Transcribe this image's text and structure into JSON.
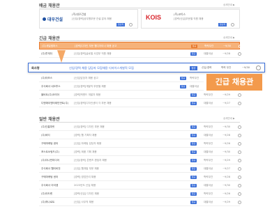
{
  "sections": {
    "premium_title": "배금 채용관",
    "premium_more": "상세안내 ▶",
    "urgent_title": "긴급 채용관",
    "urgent_more": "상세안내 ▶",
    "general_title": "일반 채용관",
    "general_more": "상세안내 ▶"
  },
  "premium_cards": [
    {
      "company": "(주)대우건설",
      "logo": "대우건설",
      "desc": "[신입/경력]공무원부문 건설 분야 채용",
      "tag": "정규직"
    },
    {
      "company": "(주)코이스",
      "logo": "KOIS",
      "desc": "[경력/신입]부문별 직원 채용",
      "tag": "정규직"
    }
  ],
  "urgent_rows": [
    {
      "company": "(주)세일캠퍼스",
      "title": "[경력]디자인 부문 웹디자이너 채용 공고",
      "badge": "정규",
      "edu": "학력무관",
      "date": "~9/30"
    },
    {
      "company": "(주)투게더",
      "title": "[신입/경력]글로벌 사업부 직원 채용",
      "badge": "정규",
      "edu": "대졸이상",
      "date": "~9/28"
    },
    {
      "company": "(주)타모스",
      "title": "[신입]담당자 채용 공고",
      "badge": "정규",
      "edu": "학력무관",
      "date": "~9/26"
    },
    {
      "company": "주식회사 네오투스",
      "title": "[신입/경력]개발직 부문별 채용",
      "badge": "정규",
      "edu": "대졸이상",
      "date": "~9/30"
    },
    {
      "company": "올비트(주)코리아",
      "title": "[경력]백엔드 개발자 채용",
      "badge": "정규",
      "edu": "학력무관",
      "date": "~9/29"
    },
    {
      "company": "디엔에이엔터테인먼트(주)",
      "title": "[신입/경력]디자인센터 각 부문 채용",
      "badge": "정규",
      "edu": "대졸이상",
      "date": "~9/27"
    }
  ],
  "highlight": {
    "company": "회사명",
    "title": "신입/경력 채용 담당자 모집채용 디자이스개발직 모집",
    "badge": "정규",
    "career": "신입/경력",
    "edu": "학력 무관",
    "date": "~9/30",
    "callout": "긴급 채용관"
  },
  "general_rows": [
    {
      "company": "(주)단홈피릿",
      "title": "[신입/경력] 디자인 부문 채용",
      "badge": "정규",
      "edu": "학력무관",
      "date": "~9/30"
    },
    {
      "company": "(주)비티",
      "title": "[경력] 웹 기획자 채용",
      "badge": "정규",
      "edu": "대졸이상",
      "date": "~9/28"
    },
    {
      "company": "구매마케팅 센터",
      "title": "[신입] 마케팅 담당자 채용",
      "badge": "정규",
      "edu": "학력무관",
      "date": "~9/26"
    },
    {
      "company": "포스트쏘링드(주)",
      "title": "[경력] 제품 기획 채용",
      "badge": "정규",
      "edu": "대졸이상",
      "date": "~9/30"
    },
    {
      "company": "(주)더나빈미디어",
      "title": "[신입/경력] 콘텐츠 편집자 채용",
      "badge": "정규",
      "edu": "학력무관",
      "date": "~9/29"
    },
    {
      "company": "주식회사 웹티비전",
      "title": "[신입] 웹개발 부문 채용",
      "badge": "정규",
      "edu": "대졸이상",
      "date": "~9/27"
    },
    {
      "company": "구매마케팅 센터",
      "title": "[경력] 영업관리 채용",
      "badge": "정규",
      "edu": "학력무관",
      "date": "~9/28"
    },
    {
      "company": "주식회사 아이엠",
      "title": "2023년도 신입 채용",
      "badge": "정규",
      "edu": "대졸이상",
      "date": "~9/30"
    },
    {
      "company": "(주)아도렌",
      "title": "[경력/신입] 디자인 채용",
      "badge": "정규",
      "edu": "학력무관",
      "date": "~9/26"
    },
    {
      "company": "(주)하나로트",
      "title": "[신입] 사무직 채용",
      "badge": "정규",
      "edu": "대졸이상",
      "date": "~9/29"
    }
  ],
  "colors": {
    "highlight_orange": "#f39a4c",
    "badge_blue": "#3b6fd8",
    "highlight_border": "#3b6fd8",
    "kois_red": "#d8232a",
    "daewoo_blue": "#1d4fa0"
  }
}
